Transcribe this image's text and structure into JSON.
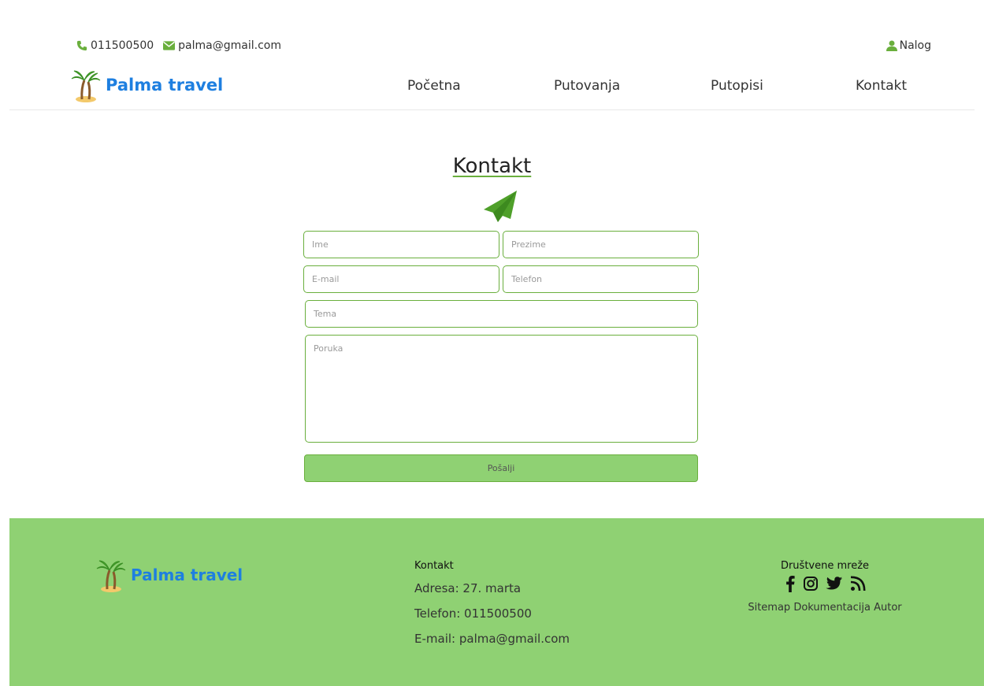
{
  "topbar": {
    "phone": "011500500",
    "email": "palma@gmail.com",
    "account_label": "Nalog",
    "icons": {
      "phone": "phone-icon",
      "email": "envelope-icon",
      "account": "user-icon"
    }
  },
  "brand": {
    "name": "Palma travel",
    "logo": "palm-tree-icon"
  },
  "nav": {
    "items": [
      {
        "label": "Početna"
      },
      {
        "label": "Putovanja"
      },
      {
        "label": "Putopisi"
      },
      {
        "label": "Kontakt"
      }
    ]
  },
  "main": {
    "title": "Kontakt",
    "title_icon": "paper-plane-icon",
    "form": {
      "first_name_placeholder": "Ime",
      "last_name_placeholder": "Prezime",
      "email_placeholder": "E-mail",
      "phone_placeholder": "Telefon",
      "subject_placeholder": "Tema",
      "message_placeholder": "Poruka",
      "submit_label": "Pošalji"
    }
  },
  "footer": {
    "brand_name": "Palma travel",
    "contact": {
      "heading": "Kontakt",
      "address": "Adresa: 27. marta",
      "phone": "Telefon: 011500500",
      "email": "E-mail: palma@gmail.com"
    },
    "social": {
      "heading": "Društvene mreže",
      "icons": [
        "facebook-icon",
        "instagram-icon",
        "twitter-icon",
        "rss-icon"
      ]
    },
    "links": [
      "Sitemap",
      "Dokumentacija",
      "Autor"
    ]
  },
  "colors": {
    "accent_green": "#6aaf3d",
    "footer_green": "#8fd173",
    "brand_blue": "#1e7fe0"
  }
}
